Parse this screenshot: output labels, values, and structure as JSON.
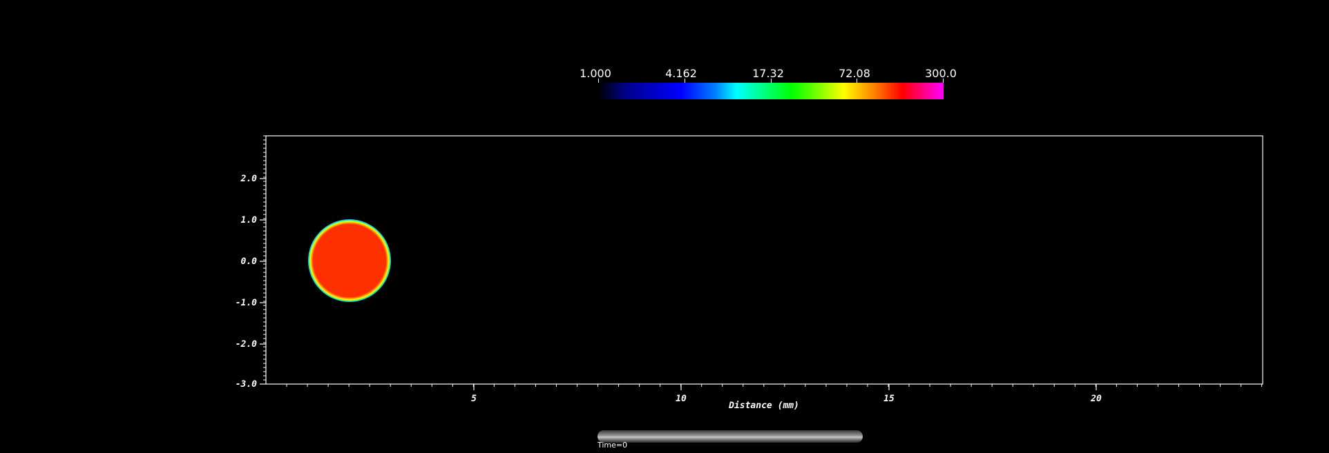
{
  "colorbar": {
    "tick_labels": [
      "1.000",
      "4.162",
      "17.32",
      "72.08",
      "300.0"
    ],
    "colors": [
      "#000000",
      "#0000ff",
      "#00ffff",
      "#00ff00",
      "#ffff00",
      "#ff0000",
      "#ff00ff"
    ],
    "scale": "log"
  },
  "plot": {
    "x_axis": {
      "label": "Distance (mm)",
      "tick_labels": [
        "5",
        "10",
        "15",
        "20"
      ],
      "tick_values": [
        5,
        10,
        15,
        20
      ],
      "range": [
        0,
        24
      ]
    },
    "y_axis": {
      "tick_labels": [
        "2.0",
        "1.0",
        "0.0",
        "-1.0",
        "-2.0",
        "-3.0"
      ],
      "tick_values": [
        2,
        1,
        0,
        -1,
        -2,
        -3
      ],
      "range": [
        -3,
        3
      ]
    },
    "object": {
      "shape": "circle",
      "center_x": 2.0,
      "center_y": 0.0,
      "radius": 1.0,
      "fill_color": "#ff3000",
      "edge_colors": [
        "#ffff00",
        "#00ff80",
        "#00c0ff"
      ]
    }
  },
  "time": {
    "label": "Time=0"
  }
}
